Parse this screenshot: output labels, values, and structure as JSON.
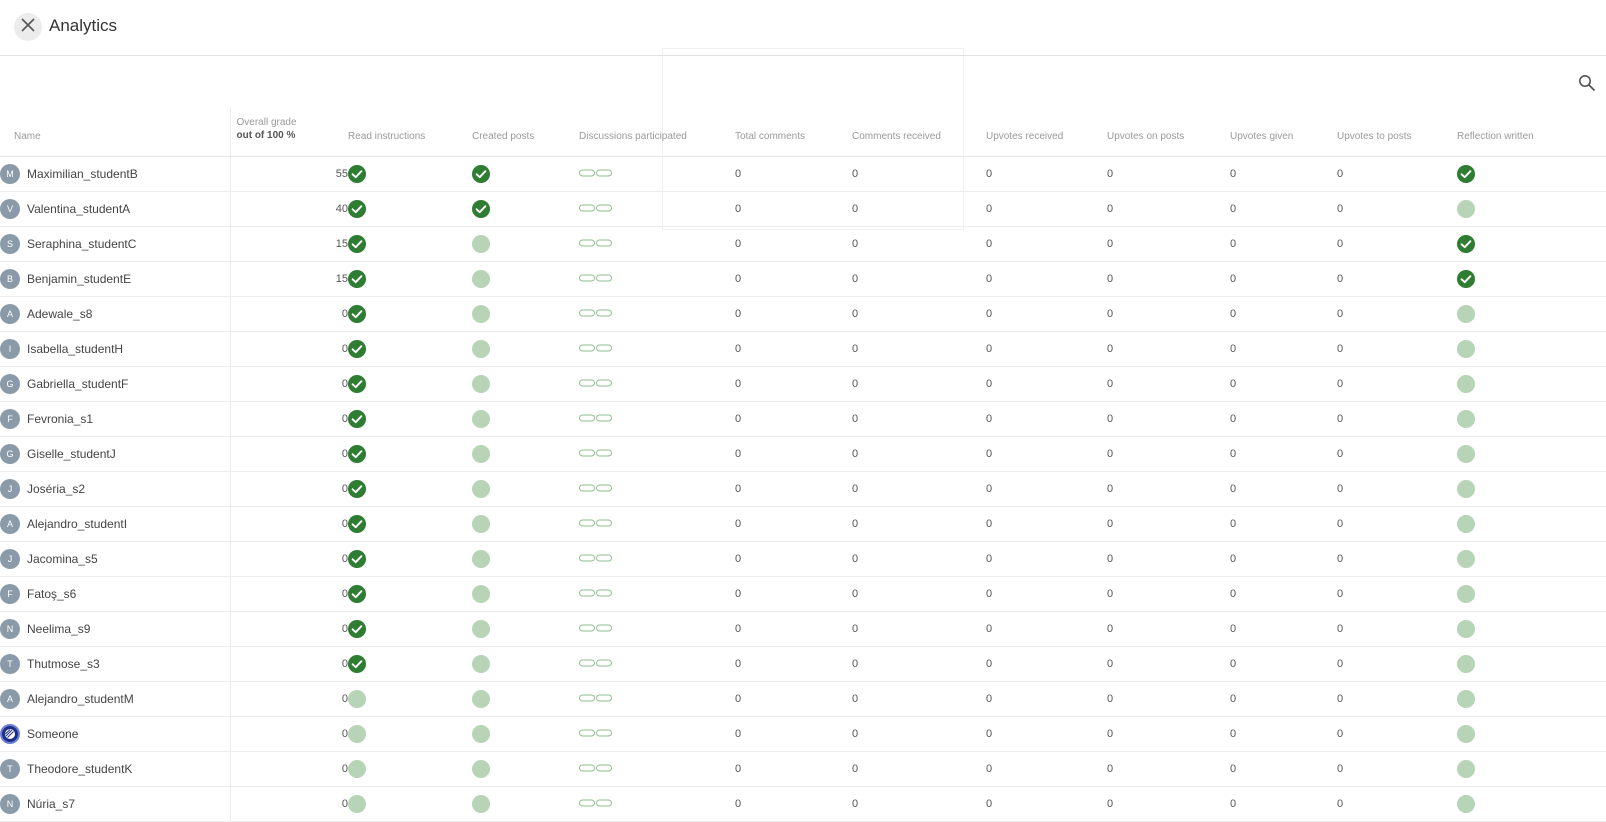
{
  "header": {
    "title": "Analytics"
  },
  "columns": {
    "name": "Name",
    "grade": "Overall grade",
    "grade_sub": "out of 100 %",
    "read_instructions": "Read instructions",
    "created_posts": "Created posts",
    "discussions": "Discussions participated",
    "total_comments": "Total comments",
    "comments_received": "Comments received",
    "upvotes_received": "Upvotes received",
    "upvotes_on_posts": "Upvotes on posts",
    "upvotes_given": "Upvotes given",
    "upvotes_to_posts": "Upvotes to posts",
    "reflection": "Reflection written"
  },
  "colors": {
    "check": "#2e7d32",
    "pending": "#b7d4b6",
    "avatar": "#8a9aa8"
  },
  "rows": [
    {
      "initial": "M",
      "name": "Maximilian_studentB",
      "grade": "55",
      "read": true,
      "created": true,
      "total_comments": "0",
      "comments_received": "0",
      "upvotes_received": "0",
      "upvotes_on_posts": "0",
      "upvotes_given": "0",
      "upvotes_to_posts": "0",
      "reflection": true
    },
    {
      "initial": "V",
      "name": "Valentina_studentA",
      "grade": "40",
      "read": true,
      "created": true,
      "total_comments": "0",
      "comments_received": "0",
      "upvotes_received": "0",
      "upvotes_on_posts": "0",
      "upvotes_given": "0",
      "upvotes_to_posts": "0",
      "reflection": false
    },
    {
      "initial": "S",
      "name": "Seraphina_studentC",
      "grade": "15",
      "read": true,
      "created": false,
      "total_comments": "0",
      "comments_received": "0",
      "upvotes_received": "0",
      "upvotes_on_posts": "0",
      "upvotes_given": "0",
      "upvotes_to_posts": "0",
      "reflection": true
    },
    {
      "initial": "B",
      "name": "Benjamin_studentE",
      "grade": "15",
      "read": true,
      "created": false,
      "total_comments": "0",
      "comments_received": "0",
      "upvotes_received": "0",
      "upvotes_on_posts": "0",
      "upvotes_given": "0",
      "upvotes_to_posts": "0",
      "reflection": true
    },
    {
      "initial": "A",
      "name": "Adewale_s8",
      "grade": "0",
      "read": true,
      "created": false,
      "total_comments": "0",
      "comments_received": "0",
      "upvotes_received": "0",
      "upvotes_on_posts": "0",
      "upvotes_given": "0",
      "upvotes_to_posts": "0",
      "reflection": false
    },
    {
      "initial": "I",
      "name": "Isabella_studentH",
      "grade": "0",
      "read": true,
      "created": false,
      "total_comments": "0",
      "comments_received": "0",
      "upvotes_received": "0",
      "upvotes_on_posts": "0",
      "upvotes_given": "0",
      "upvotes_to_posts": "0",
      "reflection": false
    },
    {
      "initial": "G",
      "name": "Gabriella_studentF",
      "grade": "0",
      "read": true,
      "created": false,
      "total_comments": "0",
      "comments_received": "0",
      "upvotes_received": "0",
      "upvotes_on_posts": "0",
      "upvotes_given": "0",
      "upvotes_to_posts": "0",
      "reflection": false
    },
    {
      "initial": "F",
      "name": "Fevronia_s1",
      "grade": "0",
      "read": true,
      "created": false,
      "total_comments": "0",
      "comments_received": "0",
      "upvotes_received": "0",
      "upvotes_on_posts": "0",
      "upvotes_given": "0",
      "upvotes_to_posts": "0",
      "reflection": false
    },
    {
      "initial": "G",
      "name": "Giselle_studentJ",
      "grade": "0",
      "read": true,
      "created": false,
      "total_comments": "0",
      "comments_received": "0",
      "upvotes_received": "0",
      "upvotes_on_posts": "0",
      "upvotes_given": "0",
      "upvotes_to_posts": "0",
      "reflection": false
    },
    {
      "initial": "J",
      "name": "Joséria_s2",
      "grade": "0",
      "read": true,
      "created": false,
      "total_comments": "0",
      "comments_received": "0",
      "upvotes_received": "0",
      "upvotes_on_posts": "0",
      "upvotes_given": "0",
      "upvotes_to_posts": "0",
      "reflection": false
    },
    {
      "initial": "A",
      "name": "Alejandro_studentI",
      "grade": "0",
      "read": true,
      "created": false,
      "total_comments": "0",
      "comments_received": "0",
      "upvotes_received": "0",
      "upvotes_on_posts": "0",
      "upvotes_given": "0",
      "upvotes_to_posts": "0",
      "reflection": false
    },
    {
      "initial": "J",
      "name": "Jacomina_s5",
      "grade": "0",
      "read": true,
      "created": false,
      "total_comments": "0",
      "comments_received": "0",
      "upvotes_received": "0",
      "upvotes_on_posts": "0",
      "upvotes_given": "0",
      "upvotes_to_posts": "0",
      "reflection": false
    },
    {
      "initial": "F",
      "name": "Fatoş_s6",
      "grade": "0",
      "read": true,
      "created": false,
      "total_comments": "0",
      "comments_received": "0",
      "upvotes_received": "0",
      "upvotes_on_posts": "0",
      "upvotes_given": "0",
      "upvotes_to_posts": "0",
      "reflection": false
    },
    {
      "initial": "N",
      "name": "Neelima_s9",
      "grade": "0",
      "read": true,
      "created": false,
      "total_comments": "0",
      "comments_received": "0",
      "upvotes_received": "0",
      "upvotes_on_posts": "0",
      "upvotes_given": "0",
      "upvotes_to_posts": "0",
      "reflection": false
    },
    {
      "initial": "T",
      "name": "Thutmose_s3",
      "grade": "0",
      "read": true,
      "created": false,
      "total_comments": "0",
      "comments_received": "0",
      "upvotes_received": "0",
      "upvotes_on_posts": "0",
      "upvotes_given": "0",
      "upvotes_to_posts": "0",
      "reflection": false
    },
    {
      "initial": "A",
      "name": "Alejandro_studentM",
      "grade": "0",
      "read": false,
      "created": false,
      "total_comments": "0",
      "comments_received": "0",
      "upvotes_received": "0",
      "upvotes_on_posts": "0",
      "upvotes_given": "0",
      "upvotes_to_posts": "0",
      "reflection": false
    },
    {
      "initial": "",
      "special": true,
      "name": "Someone",
      "grade": "0",
      "read": false,
      "created": false,
      "total_comments": "0",
      "comments_received": "0",
      "upvotes_received": "0",
      "upvotes_on_posts": "0",
      "upvotes_given": "0",
      "upvotes_to_posts": "0",
      "reflection": false
    },
    {
      "initial": "T",
      "name": "Theodore_studentK",
      "grade": "0",
      "read": false,
      "created": false,
      "total_comments": "0",
      "comments_received": "0",
      "upvotes_received": "0",
      "upvotes_on_posts": "0",
      "upvotes_given": "0",
      "upvotes_to_posts": "0",
      "reflection": false
    },
    {
      "initial": "N",
      "name": "Núria_s7",
      "grade": "0",
      "read": false,
      "created": false,
      "total_comments": "0",
      "comments_received": "0",
      "upvotes_received": "0",
      "upvotes_on_posts": "0",
      "upvotes_given": "0",
      "upvotes_to_posts": "0",
      "reflection": false
    }
  ]
}
